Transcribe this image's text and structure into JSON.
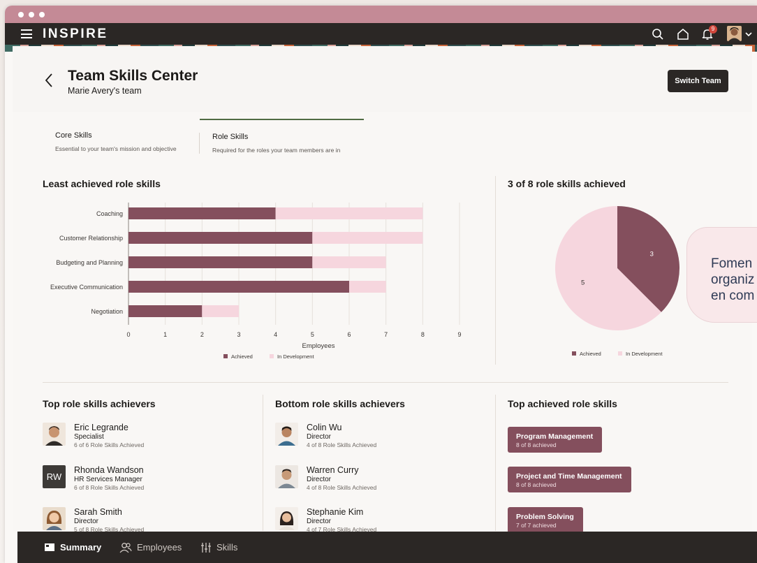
{
  "app": {
    "brand": "INSPIRE",
    "notification_count": "9"
  },
  "page": {
    "title": "Team Skills Center",
    "subtitle": "Marie Avery's team",
    "switch_label": "Switch Team"
  },
  "tabs": [
    {
      "label": "Core Skills",
      "desc": "Essential to your team's mission and objective"
    },
    {
      "label": "Role Skills",
      "desc": "Required for the roles your team members are in"
    }
  ],
  "bar_section_title": "Least achieved role skills",
  "pie_section_title": "3 of 8 role skills achieved",
  "chart_data": [
    {
      "type": "bar",
      "orientation": "horizontal",
      "stacked": true,
      "categories": [
        "Coaching",
        "Customer Relationship",
        "Budgeting and Planning",
        "Executive Communication",
        "Negotiation"
      ],
      "series": [
        {
          "name": "Achieved",
          "values": [
            4,
            5,
            5,
            6,
            2
          ],
          "color": "#844f5d"
        },
        {
          "name": "In Development",
          "values": [
            4,
            3,
            2,
            1,
            1
          ],
          "color": "#f6d6de"
        }
      ],
      "xlabel": "Employees",
      "xlim": [
        0,
        9
      ],
      "xticks": [
        "0",
        "1",
        "2",
        "3",
        "4",
        "5",
        "6",
        "7",
        "8",
        "9"
      ],
      "grid": true,
      "legend": "bottom"
    },
    {
      "type": "pie",
      "labels": [
        "Achieved",
        "In Development"
      ],
      "values": [
        3,
        5
      ],
      "colors": [
        "#844f5d",
        "#f6d6de"
      ],
      "legend": "bottom"
    }
  ],
  "top_achievers": {
    "title": "Top role skills achievers",
    "people": [
      {
        "name": "Eric Legrande",
        "role": "Specialist",
        "stat": "6 of 6 Role Skills Achieved"
      },
      {
        "name": "Rhonda Wandson",
        "role": "HR Services Manager",
        "stat": "6 of 8 Role Skills Achieved",
        "initials": "RW"
      },
      {
        "name": "Sarah Smith",
        "role": "Director",
        "stat": "5 of 8 Role Skills Achieved"
      }
    ]
  },
  "bottom_achievers": {
    "title": "Bottom role skills achievers",
    "people": [
      {
        "name": "Colin Wu",
        "role": "Director",
        "stat": "4 of 8 Role Skills Achieved"
      },
      {
        "name": "Warren Curry",
        "role": "Director",
        "stat": "4 of 8 Role Skills Achieved"
      },
      {
        "name": "Stephanie Kim",
        "role": "Director",
        "stat": "4 of 7 Role Skills Achieved"
      }
    ]
  },
  "top_skills": {
    "title": "Top achieved role skills",
    "items": [
      {
        "name": "Program Management",
        "stat": "8 of 8 achieved"
      },
      {
        "name": "Project and Time Management",
        "stat": "8 of 8 achieved"
      },
      {
        "name": "Problem Solving",
        "stat": "7 of 7 achieved"
      }
    ]
  },
  "callout_text": [
    "Fomen",
    "organiz",
    "en com"
  ],
  "bottom_nav": [
    {
      "label": "Summary",
      "icon": "summary-icon"
    },
    {
      "label": "Employees",
      "icon": "people-icon"
    },
    {
      "label": "Skills",
      "icon": "sliders-icon"
    }
  ]
}
